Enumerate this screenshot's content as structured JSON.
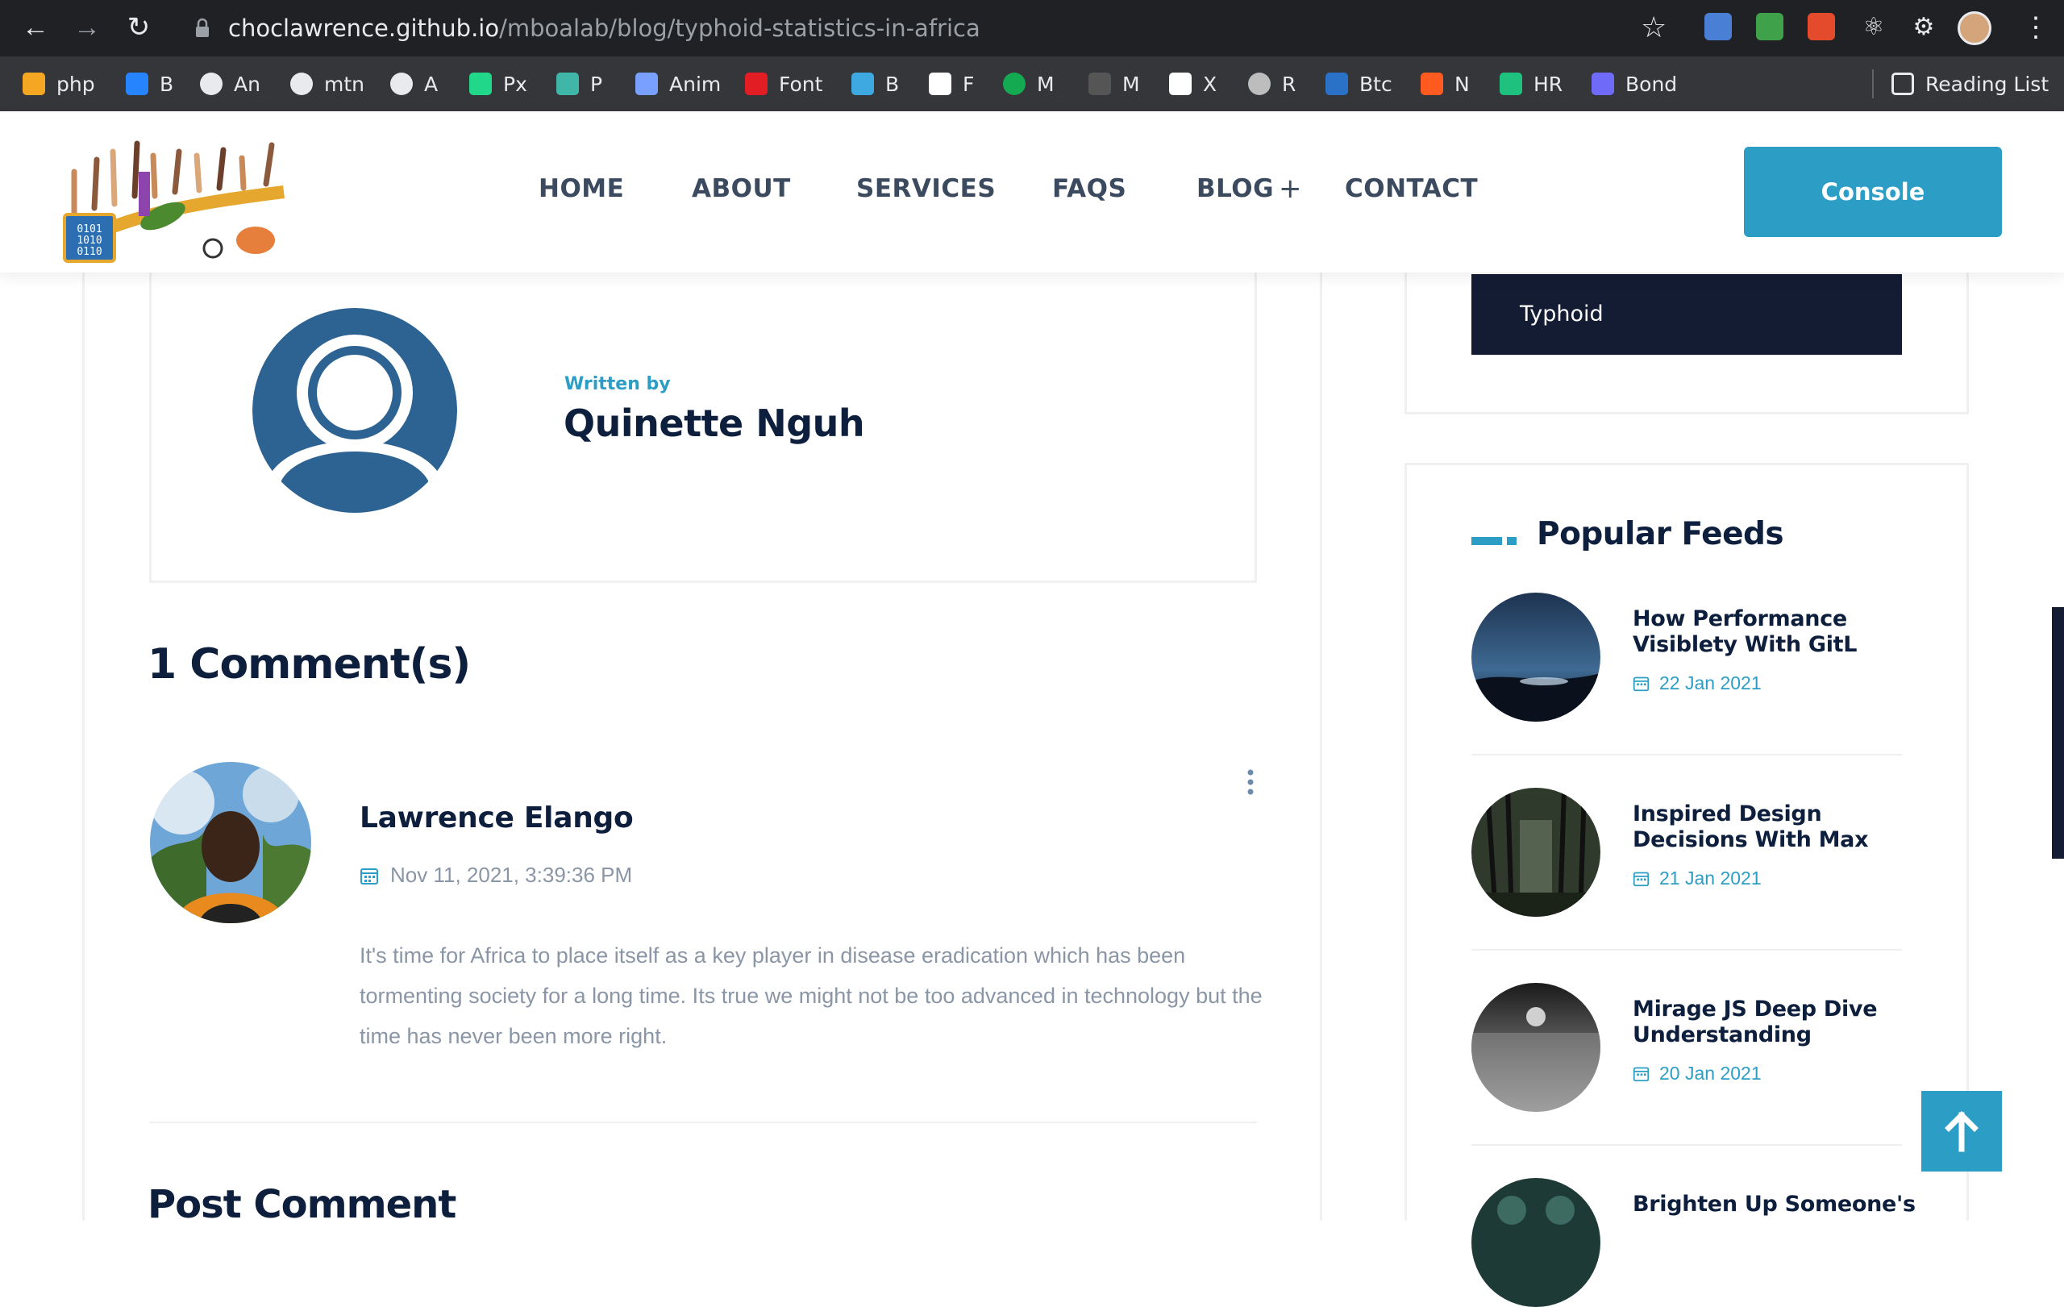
{
  "browser": {
    "url_host": "choclawrence.github.io",
    "url_path": "/mboalab/blog/typhoid-statistics-in-africa",
    "bookmarks": [
      {
        "label": "php",
        "icon": "php-icon",
        "color": "#f5a623"
      },
      {
        "label": "B",
        "icon": "bitbucket-icon",
        "color": "#2684ff"
      },
      {
        "label": "An",
        "icon": "globe-icon",
        "color": "#e8eaed"
      },
      {
        "label": "mtn",
        "icon": "globe-icon",
        "color": "#e8eaed"
      },
      {
        "label": "A",
        "icon": "github-icon",
        "color": "#e8eaed"
      },
      {
        "label": "Px",
        "icon": "px-icon",
        "color": "#21d789"
      },
      {
        "label": "P",
        "icon": "p-icon",
        "color": "#3fb6a8"
      },
      {
        "label": "Anim",
        "icon": "anim-icon",
        "color": "#7aa0ff"
      },
      {
        "label": "Font",
        "icon": "font-icon",
        "color": "#e21d24"
      },
      {
        "label": "B",
        "icon": "bd-icon",
        "color": "#3ea8e0"
      },
      {
        "label": "F",
        "icon": "f-icon",
        "color": "#ffffff"
      },
      {
        "label": "M",
        "icon": "mongodb-icon",
        "color": "#13aa52"
      },
      {
        "label": "M",
        "icon": "m-icon",
        "color": "#ffffff"
      },
      {
        "label": "X",
        "icon": "x-icon",
        "color": "#ffffff"
      },
      {
        "label": "R",
        "icon": "r-icon",
        "color": "#bdbdbd"
      },
      {
        "label": "Btc",
        "icon": "btc-icon",
        "color": "#2a72c7"
      },
      {
        "label": "N",
        "icon": "n-icon",
        "color": "#ff5a1f"
      },
      {
        "label": "HR",
        "icon": "hr-icon",
        "color": "#1ec27e"
      },
      {
        "label": "Bond",
        "icon": "bond-icon",
        "color": "#6f6af8"
      }
    ],
    "reading_list": "Reading List"
  },
  "site": {
    "nav": [
      "HOME",
      "ABOUT",
      "SERVICES",
      "FAQS",
      "BLOG",
      "CONTACT"
    ],
    "nav_blog_plus": "+",
    "console_label": "Console",
    "accent": "#2c9ec6",
    "navy": "#0d1f3c"
  },
  "author": {
    "written_by": "Written by",
    "name": "Quinette Nguh"
  },
  "comments": {
    "title": "1 Comment(s)",
    "items": [
      {
        "name": "Lawrence Elango",
        "date": "Nov 11, 2021, 3:39:36 PM",
        "text": "It's time for Africa to place itself as a key player in disease eradication which has been tormenting society for a long time. Its true we might not be too advanced in technology but the time has never been more right."
      }
    ]
  },
  "post_comment_title": "Post Comment",
  "sidebar": {
    "tag": "Typhoid",
    "popular_title": "Popular Feeds",
    "feeds": [
      {
        "title": "How Performance Visiblety With GitL",
        "date": "22 Jan 2021"
      },
      {
        "title": "Inspired Design Decisions With Max",
        "date": "21 Jan 2021"
      },
      {
        "title": "Mirage JS Deep Dive Understanding",
        "date": "20 Jan 2021"
      },
      {
        "title": "Brighten Up Someone's",
        "date": ""
      }
    ]
  }
}
